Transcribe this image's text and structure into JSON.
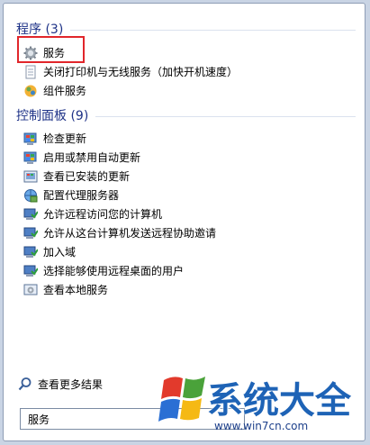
{
  "programs": {
    "header": "程序 (3)",
    "items": [
      {
        "label": "服务",
        "icon": "gear-icon"
      },
      {
        "label": "关闭打印机与无线服务（加快开机速度）",
        "icon": "document-icon"
      },
      {
        "label": "组件服务",
        "icon": "component-services-icon"
      }
    ]
  },
  "control_panel": {
    "header": "控制面板 (9)",
    "items": [
      {
        "label": "检查更新",
        "icon": "windows-update-icon"
      },
      {
        "label": "启用或禁用自动更新",
        "icon": "windows-update-icon"
      },
      {
        "label": "查看已安装的更新",
        "icon": "installed-updates-icon"
      },
      {
        "label": "配置代理服务器",
        "icon": "proxy-icon"
      },
      {
        "label": "允许远程访问您的计算机",
        "icon": "remote-access-icon"
      },
      {
        "label": "允许从这台计算机发送远程协助邀请",
        "icon": "remote-assistance-icon"
      },
      {
        "label": "加入域",
        "icon": "domain-icon"
      },
      {
        "label": "选择能够使用远程桌面的用户",
        "icon": "remote-desktop-icon"
      },
      {
        "label": "查看本地服务",
        "icon": "local-services-icon"
      }
    ]
  },
  "more_results": "查看更多结果",
  "search": {
    "value": "服务"
  },
  "watermark": {
    "title": "系统大全",
    "url": "www.win7cn.com"
  },
  "colors": {
    "header": "#1e3287",
    "highlight": "#e1262b",
    "logo": "#1e63b6"
  }
}
